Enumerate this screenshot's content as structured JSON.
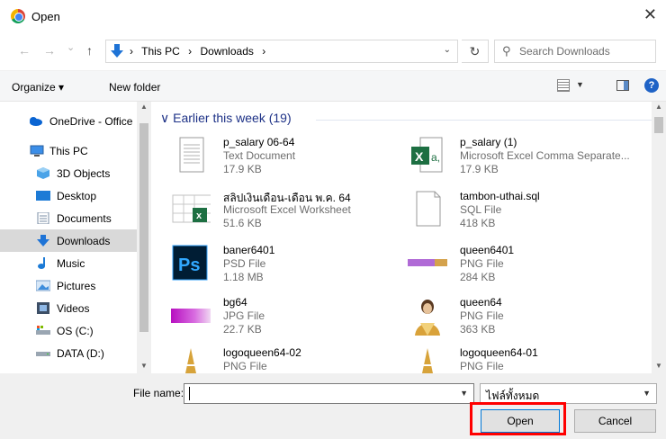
{
  "window": {
    "title": "Open",
    "close_glyph": "✕"
  },
  "address": {
    "back_glyph": "←",
    "forward_glyph": "→",
    "recent_glyph": "⌄",
    "up_glyph": "↑",
    "crumb_sep": "›",
    "crumbs": [
      "This PC",
      "Downloads"
    ],
    "dropdown_glyph": "⌄",
    "refresh_glyph": "↻"
  },
  "search": {
    "placeholder": "Search Downloads",
    "icon": "search-icon"
  },
  "toolbar": {
    "organize": "Organize ▾",
    "new_folder": "New folder",
    "help": "?",
    "view_dropdown": "▼"
  },
  "nav": {
    "items": [
      {
        "label": "OneDrive - Office",
        "icon": "onedrive-icon"
      },
      {
        "label": "This PC",
        "icon": "pc-icon"
      },
      {
        "label": "3D Objects",
        "icon": "3d-objects-icon"
      },
      {
        "label": "Desktop",
        "icon": "desktop-icon"
      },
      {
        "label": "Documents",
        "icon": "documents-icon"
      },
      {
        "label": "Downloads",
        "icon": "downloads-icon",
        "selected": true
      },
      {
        "label": "Music",
        "icon": "music-icon"
      },
      {
        "label": "Pictures",
        "icon": "pictures-icon"
      },
      {
        "label": "Videos",
        "icon": "videos-icon"
      },
      {
        "label": "OS (C:)",
        "icon": "drive-icon"
      },
      {
        "label": "DATA (D:)",
        "icon": "drive-icon"
      }
    ]
  },
  "content": {
    "group_header": "Earlier this week (19)",
    "group_chevron": "∨",
    "files": [
      {
        "name": "p_salary 06-64",
        "type": "Text Document",
        "size": "17.9 KB",
        "icon": "text-document-icon"
      },
      {
        "name": "p_salary (1)",
        "type": "Microsoft Excel Comma Separate...",
        "size": "17.9 KB",
        "icon": "excel-csv-icon"
      },
      {
        "name": "สลิปเงินเดือน-เดือน พ.ค. 64",
        "type": "Microsoft Excel Worksheet",
        "size": "51.6 KB",
        "icon": "excel-worksheet-icon"
      },
      {
        "name": "tambon-uthai.sql",
        "type": "SQL File",
        "size": "418 KB",
        "icon": "sql-file-icon"
      },
      {
        "name": "baner6401",
        "type": "PSD File",
        "size": "1.18 MB",
        "icon": "photoshop-icon"
      },
      {
        "name": "queen6401",
        "type": "PNG File",
        "size": "284 KB",
        "icon": "png-thumbnail-banner"
      },
      {
        "name": "bg64",
        "type": "JPG File",
        "size": "22.7 KB",
        "icon": "jpg-thumbnail-purple"
      },
      {
        "name": "queen64",
        "type": "PNG File",
        "size": "363 KB",
        "icon": "png-thumbnail-portrait"
      },
      {
        "name": "logoqueen64-02",
        "type": "PNG File",
        "size": "",
        "icon": "png-thumbnail-logo"
      },
      {
        "name": "logoqueen64-01",
        "type": "PNG File",
        "size": "",
        "icon": "png-thumbnail-logo"
      }
    ]
  },
  "footer": {
    "file_name_label": "File name:",
    "file_name_value": "",
    "filter_value": "ไฟล์ทั้งหมด",
    "open": "Open",
    "cancel": "Cancel"
  },
  "colors": {
    "accent": "#0078d7",
    "highlight": "#ff0000",
    "group_header": "#1e3287",
    "selected_nav": "#d9d9d9"
  }
}
